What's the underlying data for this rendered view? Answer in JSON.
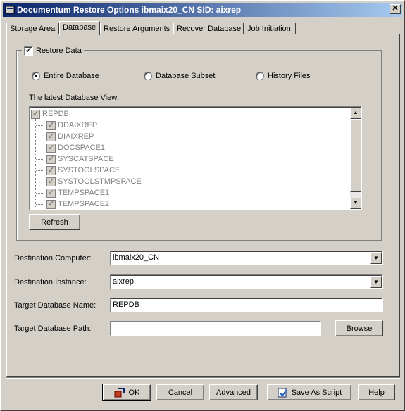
{
  "window": {
    "title": "Documentum Restore Options ibmaix20_CN  SID: aixrep",
    "close_glyph": "✕"
  },
  "tabs": [
    {
      "label": "Storage Area"
    },
    {
      "label": "Database"
    },
    {
      "label": "Restore Arguments"
    },
    {
      "label": "Recover Database"
    },
    {
      "label": "Job Initiation"
    }
  ],
  "restore_data": {
    "label": "Restore Data",
    "checked": true
  },
  "radios": [
    {
      "label": "Entire Database",
      "selected": true
    },
    {
      "label": "Database Subset",
      "selected": false
    },
    {
      "label": "History Files",
      "selected": false
    }
  ],
  "tree": {
    "heading": "The latest Database View:",
    "root": "REPDB",
    "items": [
      "DDAIXREP",
      "DIAIXREP",
      "DOCSPACE1",
      "SYSCATSPACE",
      "SYSTOOLSPACE",
      "SYSTOOLSTMPSPACE",
      "TEMPSPACE1",
      "TEMPSPACE2"
    ]
  },
  "refresh_label": "Refresh",
  "fields": {
    "dest_computer_label": "Destination Computer:",
    "dest_computer_value": "ibmaix20_CN",
    "dest_instance_label": "Destination Instance:",
    "dest_instance_value": "aixrep",
    "target_name_label": "Target Database Name:",
    "target_name_value": "REPDB",
    "target_path_label": "Target Database Path:",
    "target_path_value": "",
    "browse_label": "Browse"
  },
  "footer": {
    "ok": "OK",
    "cancel": "Cancel",
    "advanced": "Advanced",
    "save_script": "Save As Script",
    "help": "Help"
  }
}
